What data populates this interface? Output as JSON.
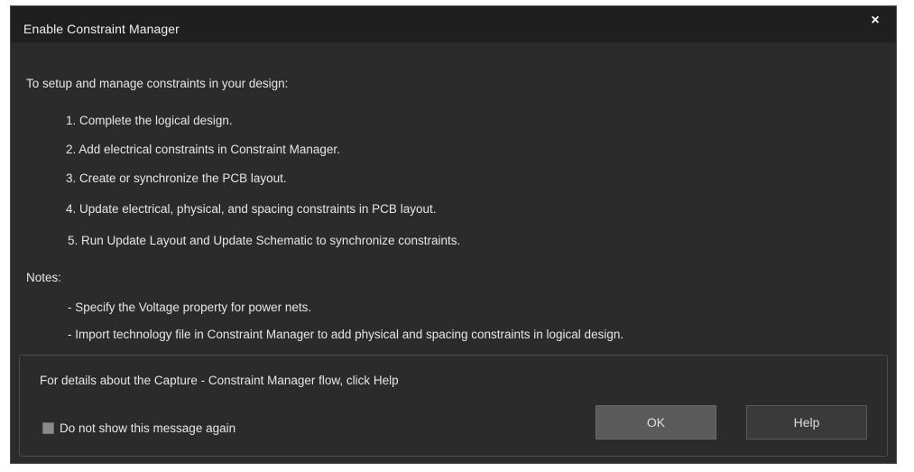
{
  "dialog": {
    "title": "Enable Constraint Manager",
    "close_glyph": "×",
    "intro": "To setup and manage constraints in your design:",
    "steps": [
      "1. Complete the logical design.",
      "2. Add electrical constraints in Constraint Manager.",
      "3. Create or synchronize the PCB layout.",
      "4. Update electrical, physical, and spacing constraints in PCB layout.",
      "5. Run Update Layout and Update Schematic to synchronize constraints."
    ],
    "notes_heading": "Notes:",
    "notes": [
      "- Specify the Voltage property for power nets.",
      "- Import technology file in Constraint Manager to add physical and spacing constraints in logical design."
    ],
    "footer": {
      "details_text": "For details about the Capture - Constraint Manager flow, click  Help",
      "checkbox_label": "Do not show this message again",
      "ok_label": "OK",
      "help_label": "Help"
    }
  }
}
